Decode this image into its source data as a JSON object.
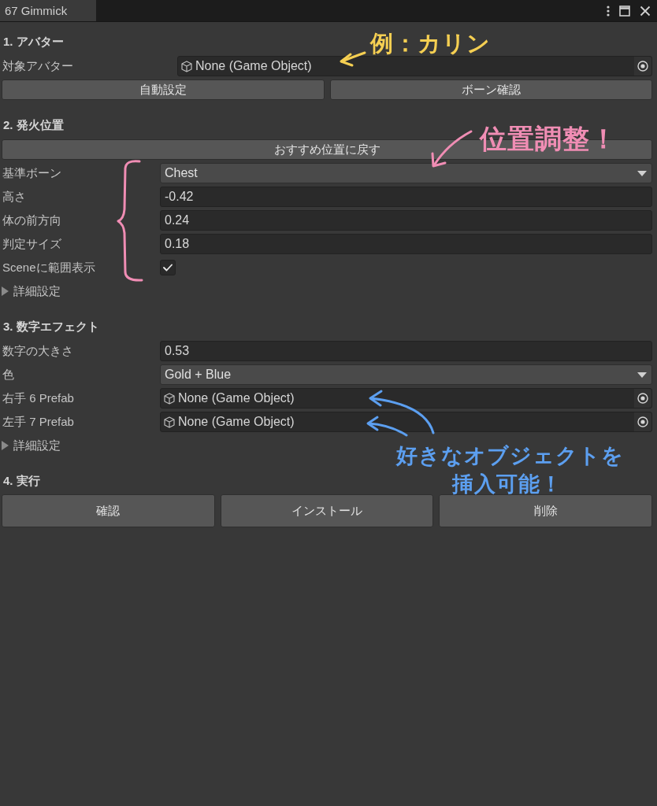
{
  "window": {
    "tab": "67 Gimmick"
  },
  "sections": [
    {
      "title": "1. アバター",
      "rows": [
        {
          "kind": "object",
          "label": "対象アバター",
          "value": "None (Game Object)"
        },
        {
          "kind": "buttons",
          "buttons": [
            "自動設定",
            "ボーン確認"
          ]
        }
      ],
      "note": {
        "lines": [
          "例：カリン"
        ],
        "color": "#f5cf52"
      }
    },
    {
      "title": "2. 発火位置",
      "rows": [
        {
          "kind": "buttons",
          "buttons": [
            "おすすめ位置に戻す"
          ]
        },
        {
          "kind": "dropdown",
          "label": "基準ボーン",
          "value": "Chest"
        },
        {
          "kind": "number",
          "label": "高さ",
          "value": "-0.42"
        },
        {
          "kind": "number",
          "label": "体の前方向",
          "value": "0.24"
        },
        {
          "kind": "number",
          "label": "判定サイズ",
          "value": "0.18"
        },
        {
          "kind": "checkbox",
          "label": "Sceneに範囲表示",
          "checked": true
        },
        {
          "kind": "foldout",
          "label": "詳細設定",
          "expanded": false
        }
      ],
      "note": {
        "lines": [
          "位置調整！"
        ],
        "color": "#f08db4"
      }
    },
    {
      "title": "3. 数字エフェクト",
      "rows": [
        {
          "kind": "number",
          "label": "数字の大きさ",
          "value": "0.53"
        },
        {
          "kind": "dropdown",
          "label": "色",
          "value": "Gold + Blue"
        },
        {
          "kind": "object",
          "label": "右手 6 Prefab",
          "value": "None (Game Object)"
        },
        {
          "kind": "object",
          "label": "左手 7 Prefab",
          "value": "None (Game Object)"
        },
        {
          "kind": "foldout",
          "label": "詳細設定",
          "expanded": false
        }
      ],
      "note": {
        "lines": [
          "好きなオブジェクトを",
          "挿入可能！"
        ],
        "color": "#5c9ff0"
      }
    },
    {
      "title": "4. 実行",
      "rows": [
        {
          "kind": "run_buttons",
          "buttons": [
            "確認",
            "インストール",
            "削除"
          ]
        }
      ]
    }
  ]
}
